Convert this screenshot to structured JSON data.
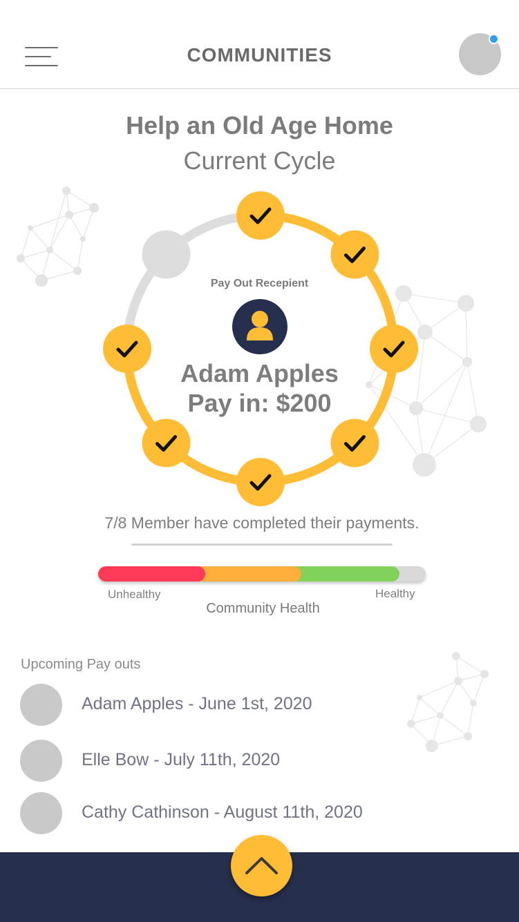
{
  "header": {
    "title": "COMMUNITIES",
    "menu_icon": "hamburger-menu-icon",
    "profile_icon": "profile-avatar",
    "notification_color": "#2ea0ee"
  },
  "community": {
    "name": "Help an Old Age Home",
    "cycle_label": "Current Cycle"
  },
  "cycle": {
    "total_members": 8,
    "completed_members": 7,
    "recipient_label": "Pay Out Recepient",
    "recipient_name": "Adam Apples",
    "pay_in": "Pay in: $200",
    "status_text": "7/8 Member have completed their payments.",
    "check_icon": "check-icon",
    "colors": {
      "completed": "#ffbc35",
      "pending": "#dddddd",
      "avatar_bg": "#262f4e"
    }
  },
  "health": {
    "title": "Community Health",
    "low_label": "Unhealthy",
    "high_label": "Healthy",
    "level": 0.92,
    "colors": {
      "bad": "#ff3a58",
      "medium": "#ffae3c",
      "good": "#80d25a",
      "track": "#d9d9d9"
    }
  },
  "upcoming": {
    "title": "Upcoming Pay outs",
    "items": [
      {
        "label": "Adam Apples - June 1st, 2020"
      },
      {
        "label": "Elle Bow - July 11th, 2020"
      },
      {
        "label": "Cathy Cathinson - August 11th, 2020"
      }
    ]
  },
  "footer": {
    "action_icon": "chevron-up-icon",
    "bar_color": "#262f4d",
    "button_color": "#ffbc35"
  }
}
